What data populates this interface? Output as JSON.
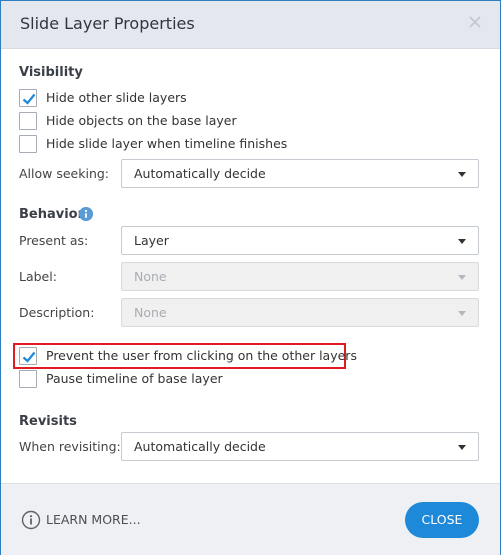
{
  "dialog": {
    "title": "Slide Layer Properties",
    "close_icon": "close-x-icon"
  },
  "visibility": {
    "heading": "Visibility",
    "options": [
      {
        "label": "Hide other slide layers",
        "checked": true
      },
      {
        "label": "Hide objects on the base layer",
        "checked": false
      },
      {
        "label": "Hide slide layer when timeline finishes",
        "checked": false
      }
    ],
    "allow_seeking_label": "Allow seeking:",
    "allow_seeking_value": "Automatically decide"
  },
  "behavior": {
    "heading": "Behavior",
    "info_icon": "info-icon",
    "present_as_label": "Present as:",
    "present_as_value": "Layer",
    "label_label": "Label:",
    "label_value": "None",
    "description_label": "Description:",
    "description_value": "None",
    "options": [
      {
        "label": "Prevent the user from clicking on the other layers",
        "checked": true
      },
      {
        "label": "Pause timeline of base layer",
        "checked": false
      }
    ]
  },
  "revisits": {
    "heading": "Revisits",
    "when_revisiting_label": "When revisiting:",
    "when_revisiting_value": "Automatically decide"
  },
  "footer": {
    "learn_more_label": "LEARN MORE...",
    "close_label": "CLOSE"
  },
  "colors": {
    "accent": "#1e88d9",
    "highlight_border": "#e01b24",
    "titlebar": "#e4e8ee"
  }
}
